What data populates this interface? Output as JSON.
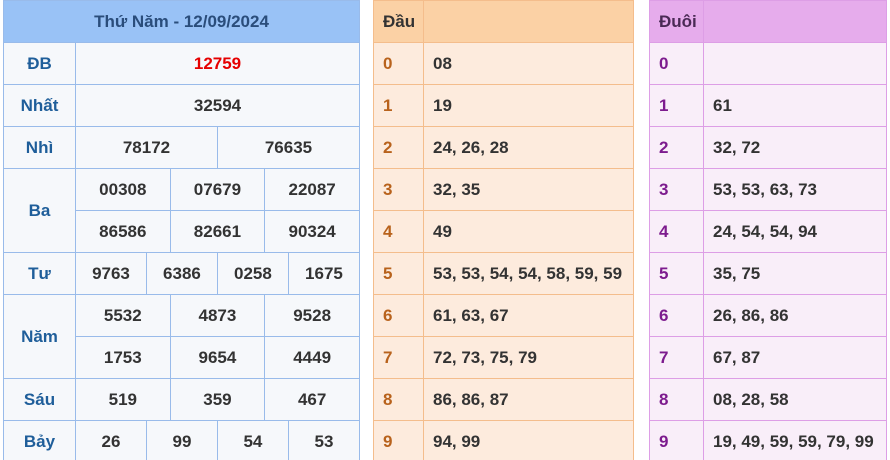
{
  "header": {
    "title": "Thứ Năm - 12/09/2024"
  },
  "prizes": {
    "db": {
      "label": "ĐB",
      "values": [
        "12759"
      ]
    },
    "nhat": {
      "label": "Nhất",
      "values": [
        "32594"
      ]
    },
    "nhi": {
      "label": "Nhì",
      "values": [
        "78172",
        "76635"
      ]
    },
    "ba": {
      "label": "Ba",
      "values": [
        "00308",
        "07679",
        "22087",
        "86586",
        "82661",
        "90324"
      ]
    },
    "tu": {
      "label": "Tư",
      "values": [
        "9763",
        "6386",
        "0258",
        "1675"
      ]
    },
    "nam": {
      "label": "Năm",
      "values": [
        "5532",
        "4873",
        "9528",
        "1753",
        "9654",
        "4449"
      ]
    },
    "sau": {
      "label": "Sáu",
      "values": [
        "519",
        "359",
        "467"
      ]
    },
    "bay": {
      "label": "Bảy",
      "values": [
        "26",
        "99",
        "54",
        "53"
      ]
    }
  },
  "dau": {
    "header": "Đầu",
    "rows": [
      {
        "digit": "0",
        "values": "08"
      },
      {
        "digit": "1",
        "values": "19"
      },
      {
        "digit": "2",
        "values": "24, 26, 28"
      },
      {
        "digit": "3",
        "values": "32, 35"
      },
      {
        "digit": "4",
        "values": "49"
      },
      {
        "digit": "5",
        "values": "53, 53, 54, 54, 58, 59, 59"
      },
      {
        "digit": "6",
        "values": "61, 63, 67"
      },
      {
        "digit": "7",
        "values": "72, 73, 75, 79"
      },
      {
        "digit": "8",
        "values": "86, 86, 87"
      },
      {
        "digit": "9",
        "values": "94, 99"
      }
    ]
  },
  "duoi": {
    "header": "Đuôi",
    "rows": [
      {
        "digit": "0",
        "values": ""
      },
      {
        "digit": "1",
        "values": "61"
      },
      {
        "digit": "2",
        "values": "32, 72"
      },
      {
        "digit": "3",
        "values": "53, 53, 63, 73"
      },
      {
        "digit": "4",
        "values": "24, 54, 54, 94"
      },
      {
        "digit": "5",
        "values": "35, 75"
      },
      {
        "digit": "6",
        "values": "26, 86, 86"
      },
      {
        "digit": "7",
        "values": "67, 87"
      },
      {
        "digit": "8",
        "values": "08, 28, 58"
      },
      {
        "digit": "9",
        "values": "19, 49, 59, 59, 79, 99"
      }
    ]
  },
  "colors": {
    "special_prize": "#e60000",
    "results_header": "#99c2f6",
    "dau_header": "#fbd1a5",
    "duoi_header": "#e6acec"
  }
}
